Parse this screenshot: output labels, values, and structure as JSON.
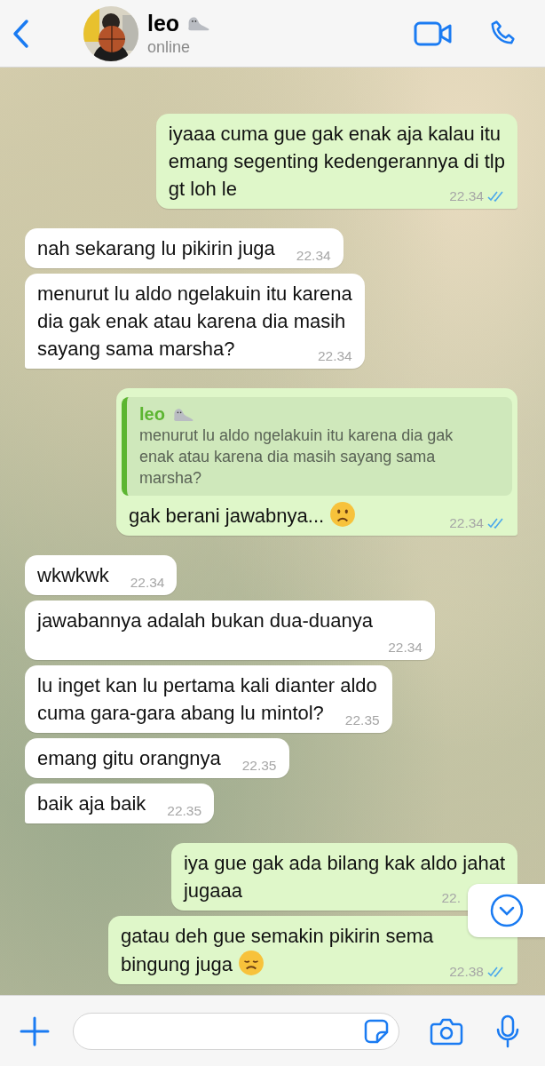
{
  "header": {
    "name": "leo",
    "status": "online"
  },
  "messages": [
    {
      "kind": "text",
      "outgoing": true,
      "lines": [
        "iyaaa cuma gue gak enak aja kalau itu",
        "emang segenting kedengerannya di tlp",
        "gt loh le"
      ],
      "time": "22.34",
      "read": true,
      "tail": true
    },
    {
      "kind": "text",
      "outgoing": false,
      "lines": [
        "nah sekarang lu pikirin juga"
      ],
      "time": "22.34",
      "read": false,
      "tail": false
    },
    {
      "kind": "text",
      "outgoing": false,
      "lines": [
        "menurut lu aldo ngelakuin itu karena",
        "dia gak enak atau karena dia masih",
        "sayang sama marsha?"
      ],
      "time": "22.34",
      "read": false,
      "tail": true
    },
    {
      "kind": "reply",
      "outgoing": true,
      "quote": {
        "author": "leo",
        "lines": [
          "menurut lu aldo ngelakuin itu karena dia gak",
          "enak atau karena dia masih sayang sama",
          "marsha?"
        ]
      },
      "lines": [
        "gak berani jawabnya..."
      ],
      "emoji": {
        "kind": "frown"
      },
      "time": "22.34",
      "read": true,
      "tail": true
    },
    {
      "kind": "text",
      "outgoing": false,
      "lines": [
        "wkwkwk"
      ],
      "time": "22.34",
      "read": false,
      "tail": false
    },
    {
      "kind": "text",
      "outgoing": false,
      "lines": [
        "jawabannya adalah bukan dua-duanya"
      ],
      "time": "22.34",
      "read": false,
      "tail": false
    },
    {
      "kind": "text",
      "outgoing": false,
      "lines": [
        "lu inget kan lu pertama kali dianter aldo",
        "cuma gara-gara abang lu mintol?"
      ],
      "time": "22.35",
      "read": false,
      "tail": false
    },
    {
      "kind": "text",
      "outgoing": false,
      "lines": [
        "emang gitu orangnya"
      ],
      "time": "22.35",
      "read": false,
      "tail": false
    },
    {
      "kind": "text",
      "outgoing": false,
      "lines": [
        "baik aja baik"
      ],
      "time": "22.35",
      "read": false,
      "tail": true
    },
    {
      "kind": "text",
      "outgoing": true,
      "lines": [
        "iya gue gak ada bilang kak aldo jahat",
        "jugaaa"
      ],
      "time": "22.",
      "read": false,
      "tail": false
    },
    {
      "kind": "text",
      "outgoing": true,
      "lines": [
        "gatau deh gue semakin pikirin sema",
        "bingung juga"
      ],
      "emoji": {
        "kind": "sad"
      },
      "time": "22.38",
      "read": true,
      "tail": true
    }
  ]
}
